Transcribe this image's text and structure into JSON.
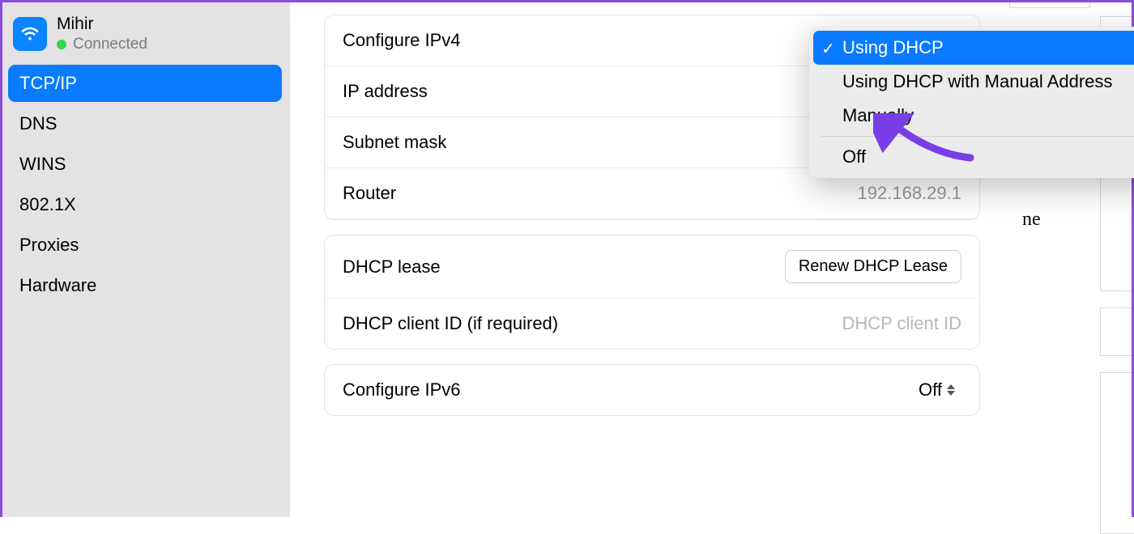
{
  "network": {
    "name": "Mihir",
    "status": "Connected"
  },
  "sidebar": {
    "items": [
      "TCP/IP",
      "DNS",
      "WINS",
      "802.1X",
      "Proxies",
      "Hardware"
    ],
    "selectedIndex": 0
  },
  "group1": {
    "configureIPv4Label": "Configure IPv4",
    "ipAddressLabel": "IP address",
    "ipAddressValue": "",
    "subnetMaskLabel": "Subnet mask",
    "subnetMaskValue": "",
    "routerLabel": "Router",
    "routerValue": "192.168.29.1"
  },
  "group2": {
    "dhcpLeaseLabel": "DHCP lease",
    "renewButton": "Renew DHCP Lease",
    "clientIdLabel": "DHCP client ID (if required)",
    "clientIdPlaceholder": "DHCP client ID"
  },
  "group3": {
    "configureIPv6Label": "Configure IPv6",
    "ipv6Value": "Off"
  },
  "popup": {
    "options": [
      "Using DHCP",
      "Using DHCP with Manual Address",
      "Manually",
      "Off"
    ],
    "selectedIndex": 0
  },
  "bgText": "ne"
}
